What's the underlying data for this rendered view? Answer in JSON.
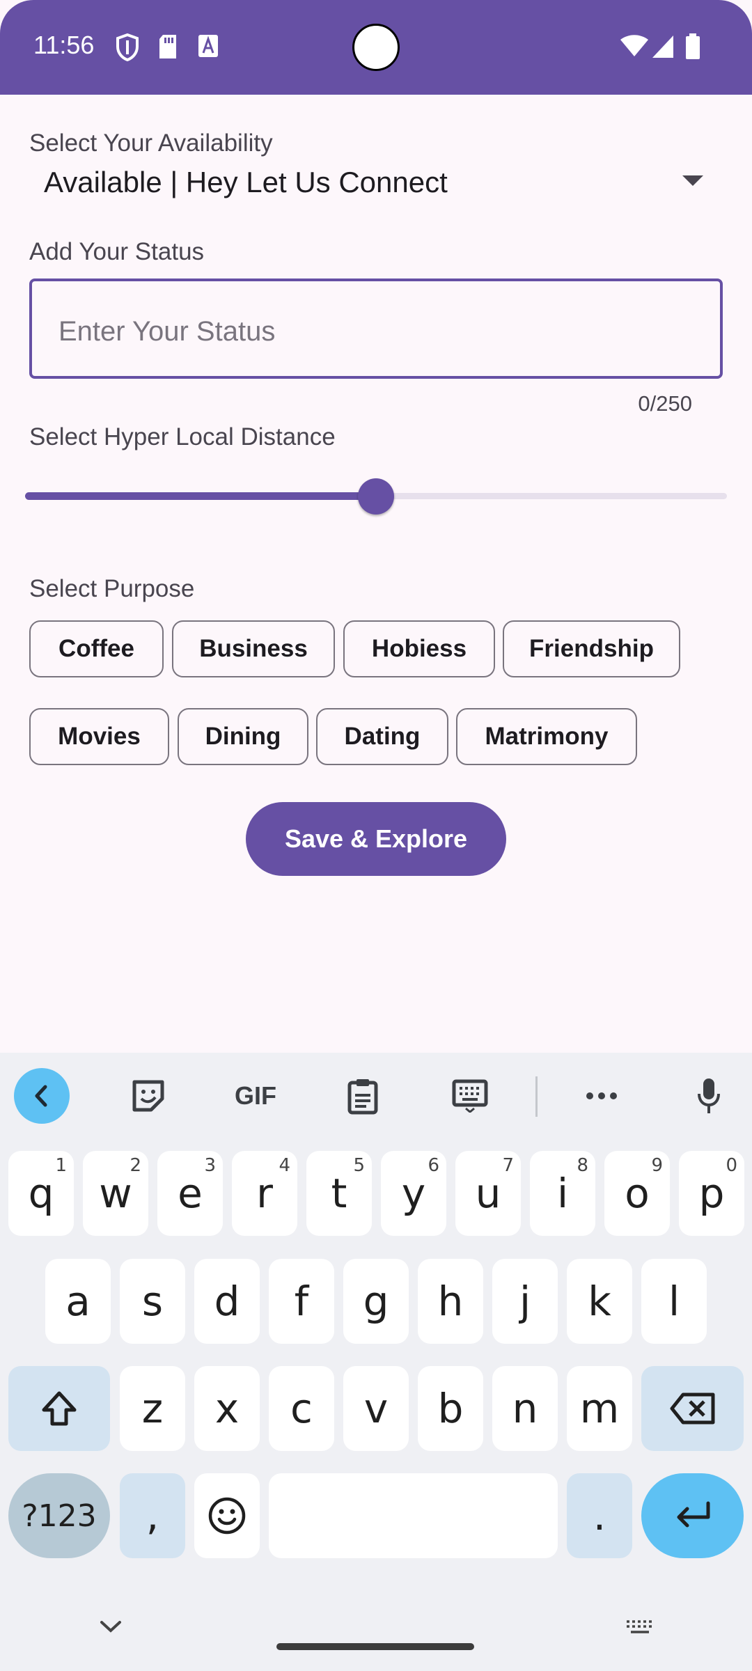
{
  "status_bar": {
    "time": "11:56",
    "icons": [
      "shield-icon",
      "sd-card-icon",
      "text-a-icon",
      "wifi-icon",
      "cell-signal-icon",
      "battery-icon"
    ]
  },
  "form": {
    "availability_label": "Select Your Availability",
    "availability_value": "Available | Hey Let Us Connect",
    "status_label": "Add Your Status",
    "status_placeholder": "Enter Your Status",
    "status_value": "",
    "char_counter": "0/250",
    "distance_label": "Select Hyper Local Distance",
    "distance_fraction": 0.5,
    "purpose_label": "Select Purpose",
    "purposes": [
      "Coffee",
      "Business",
      "Hobiess",
      "Friendship",
      "Movies",
      "Dining",
      "Dating",
      "Matrimony"
    ],
    "save_label": "Save & Explore"
  },
  "colors": {
    "primary": "#6650a4",
    "background": "#fdf7fb",
    "keyboard_bg": "#eff0f4",
    "keyboard_accent": "#5ec1f3"
  },
  "keyboard": {
    "toolbar": [
      "back-icon",
      "sticker-icon",
      "GIF",
      "clipboard-icon",
      "keyboard-layout-icon",
      "more-icon",
      "microphone-icon"
    ],
    "gif_label": "GIF",
    "row1": [
      {
        "k": "q",
        "h": "1"
      },
      {
        "k": "w",
        "h": "2"
      },
      {
        "k": "e",
        "h": "3"
      },
      {
        "k": "r",
        "h": "4"
      },
      {
        "k": "t",
        "h": "5"
      },
      {
        "k": "y",
        "h": "6"
      },
      {
        "k": "u",
        "h": "7"
      },
      {
        "k": "i",
        "h": "8"
      },
      {
        "k": "o",
        "h": "9"
      },
      {
        "k": "p",
        "h": "0"
      }
    ],
    "row2": [
      "a",
      "s",
      "d",
      "f",
      "g",
      "h",
      "j",
      "k",
      "l"
    ],
    "row3": [
      "z",
      "x",
      "c",
      "v",
      "b",
      "n",
      "m"
    ],
    "sym_label": "?123",
    "comma": ",",
    "period": "."
  }
}
